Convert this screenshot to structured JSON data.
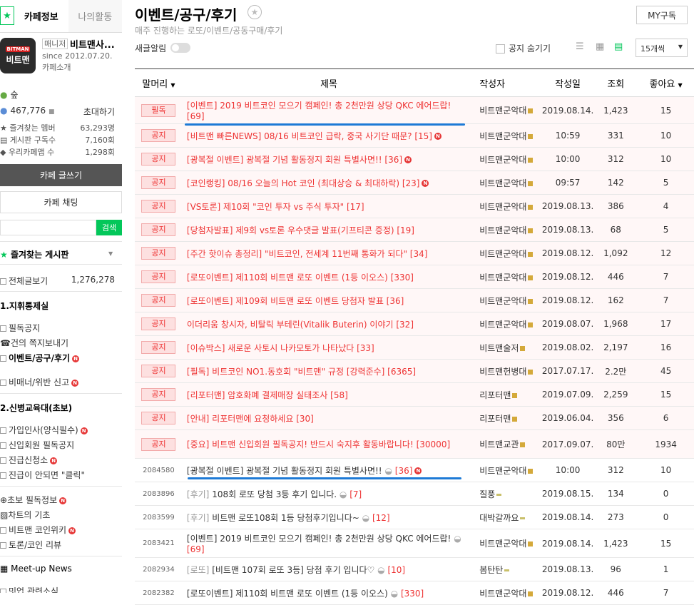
{
  "sidebar": {
    "tab_info": "카페정보",
    "tab_activity": "나의활동",
    "logo_top": "BITMAN",
    "logo_text": "비트맨",
    "manager_label": "매니저",
    "manager_name": "비트맨사...",
    "since": "since 2012.07.20.",
    "intro": "카페소개",
    "level": "숲",
    "members": "467,776",
    "invite": "초대하기",
    "fav_members_label": "즐겨찾는 멤버",
    "fav_members": "63,293명",
    "board_sub_label": "게시판 구독수",
    "board_sub": "7,160회",
    "our_cafe_label": "우리카페앱 수",
    "our_cafe": "1,298회",
    "write_btn": "카페 글쓰기",
    "chat_btn": "카페 채팅",
    "search_btn": "검색",
    "fav_boards": "즐겨찾는 게시판",
    "all_posts": "전체글보기",
    "all_posts_count": "1,276,278",
    "sec1": "1.지휘통제실",
    "menu1": [
      "필독공지",
      "건의 쪽지보내기",
      "이벤트/공구/후기"
    ],
    "menu2": "비매너/위반 신고",
    "sec2": "2.신병교육대(초보)",
    "menu3": [
      "가입인사(양식필수)",
      "신입회원 필독공지",
      "진급신청소",
      "진급이 안되면 \"클릭\""
    ],
    "menu4": [
      "초보 필독정보",
      "차트의 기초",
      "비트맨 코인위키",
      "토론/코인 리뷰"
    ],
    "meetup": "Meet-up News",
    "last_item": "밋업 관련소식"
  },
  "header": {
    "title": "이벤트/공구/후기",
    "subtitle": "매주 진행하는 로또/이벤트/공동구매/후기",
    "my_btn": "MY구독",
    "new_alert": "새글알림",
    "hide_notice": "공지 숨기기",
    "per_page": "15개씩"
  },
  "columns": [
    "말머리",
    "제목",
    "작성자",
    "작성일",
    "조회",
    "좋아요"
  ],
  "rows": [
    {
      "type": "notice",
      "badge": "필독",
      "title": "[이벤트] 2019 비트코인 모으기 캠페인! 총 2천만원 상당 QKC 에어드랍! [69]",
      "author": "비트맨군악대",
      "date": "2019.08.14.",
      "views": "1,423",
      "likes": "15",
      "two": true
    },
    {
      "type": "notice",
      "badge": "공지",
      "title": "[비트맨 빠른NEWS] 08/16 비트코인 급락, 중국 사기단 때문? [15]",
      "author": "비트맨군악대",
      "date": "10:59",
      "views": "331",
      "likes": "10",
      "new": true
    },
    {
      "type": "notice",
      "badge": "공지",
      "title": "[광복절 이벤트] 광복절 기념 활동정지 회원 특별사면!! [36]",
      "author": "비트맨군악대",
      "date": "10:00",
      "views": "312",
      "likes": "10",
      "new": true
    },
    {
      "type": "notice",
      "badge": "공지",
      "title": "[코인랭킹] 08/16 오늘의 Hot 코인 (최대상승 & 최대하락) [23]",
      "author": "비트맨군악대",
      "date": "09:57",
      "views": "142",
      "likes": "5",
      "new": true
    },
    {
      "type": "notice",
      "badge": "공지",
      "title": "[VS토론] 제10회 \"코인 투자 vs 주식 투자\" [17]",
      "author": "비트맨군악대",
      "date": "2019.08.13.",
      "views": "386",
      "likes": "4"
    },
    {
      "type": "notice",
      "badge": "공지",
      "title": "[당첨자발표] 제9회 vs토론 우수댓글 발표(기프티콘 증정) [19]",
      "author": "비트맨군악대",
      "date": "2019.08.13.",
      "views": "68",
      "likes": "5"
    },
    {
      "type": "notice",
      "badge": "공지",
      "title": "[주간 핫이슈 총정리] \"비트코인, 전세계 11번째 통화가 되다\" [34]",
      "author": "비트맨군악대",
      "date": "2019.08.12.",
      "views": "1,092",
      "likes": "12"
    },
    {
      "type": "notice",
      "badge": "공지",
      "title": "[로또이벤트] 제110회 비트맨 로또 이벤트 (1등 이오스) [330]",
      "author": "비트맨군악대",
      "date": "2019.08.12.",
      "views": "446",
      "likes": "7"
    },
    {
      "type": "notice",
      "badge": "공지",
      "title": "[로또이벤트] 제109회 비트맨 로또 이벤트 당첨자 발표 [36]",
      "author": "비트맨군악대",
      "date": "2019.08.12.",
      "views": "162",
      "likes": "7"
    },
    {
      "type": "notice",
      "badge": "공지",
      "title": "이더리움 창시자, 비탈릭 부테린(Vitalik Buterin) 이야기 [32]",
      "author": "비트맨군악대",
      "date": "2019.08.07.",
      "views": "1,968",
      "likes": "17"
    },
    {
      "type": "notice",
      "badge": "공지",
      "title": "[이슈박스] 새로운 사토시 나카모토가 나타났다 [33]",
      "author": "비트맨술저",
      "date": "2019.08.02.",
      "views": "2,197",
      "likes": "16"
    },
    {
      "type": "notice",
      "badge": "공지",
      "title": "[필독] 비트코인 NO1.동호회 \"비트맨\" 규정 [강력준수] [6365]",
      "author": "비트맨헌병대",
      "date": "2017.07.17.",
      "views": "2.2만",
      "likes": "45"
    },
    {
      "type": "notice",
      "badge": "공지",
      "title": "[리포터맨] 암호화폐 결제매장 실태조사 [58]",
      "author": "리포터맨",
      "date": "2019.07.09.",
      "views": "2,259",
      "likes": "15"
    },
    {
      "type": "notice",
      "badge": "공지",
      "title": "[안내] 리포터맨에 요청하세요 [30]",
      "author": "리포터맨",
      "date": "2019.06.04.",
      "views": "356",
      "likes": "6"
    },
    {
      "type": "notice",
      "badge": "공지",
      "title": "[중요] 비트맨 신입회원 필독공지! 반드시 숙지후 활동바랍니다! [30000]",
      "author": "비트맨교관",
      "date": "2017.09.07.",
      "views": "80만",
      "likes": "1934",
      "two": true
    },
    {
      "type": "post",
      "num": "2084580",
      "cat": "",
      "title": "[광복절 이벤트] 광복절 기념 활동정지 회원 특별사면!!",
      "cmt": "[36]",
      "author": "비트맨군악대",
      "date": "10:00",
      "views": "312",
      "likes": "10",
      "new": true
    },
    {
      "type": "post",
      "num": "2083896",
      "cat": "[후기]",
      "title": "108회 로또 당첨 3등 후기 입니다.",
      "cmt": "[7]",
      "author": "질풍",
      "date": "2019.08.15.",
      "views": "134",
      "likes": "0"
    },
    {
      "type": "post",
      "num": "2083599",
      "cat": "[후기]",
      "title": "비트맨 로또108회 1등 당첨후기입니다~",
      "cmt": "[12]",
      "author": "대박갈까요",
      "date": "2019.08.14.",
      "views": "273",
      "likes": "0"
    },
    {
      "type": "post",
      "num": "2083421",
      "cat": "",
      "title": "[이벤트] 2019 비트코인 모으기 캠페인! 총 2천만원 상당 QKC 에어드랍!",
      "cmt": "[69]",
      "author": "비트맨군악대",
      "date": "2019.08.14.",
      "views": "1,423",
      "likes": "15",
      "two": true
    },
    {
      "type": "post",
      "num": "2082934",
      "cat": "[로또]",
      "title": "[비트맨 107회 로또 3등] 당첨 후기 입니다♡",
      "cmt": "[10]",
      "author": "봄탄탄",
      "date": "2019.08.13.",
      "views": "96",
      "likes": "1"
    },
    {
      "type": "post",
      "num": "2082382",
      "cat": "",
      "title": "[로또이벤트] 제110회 비트맨 로또 이벤트 (1등 이오스)",
      "cmt": "[330]",
      "author": "비트맨군악대",
      "date": "2019.08.12.",
      "views": "446",
      "likes": "7"
    }
  ]
}
